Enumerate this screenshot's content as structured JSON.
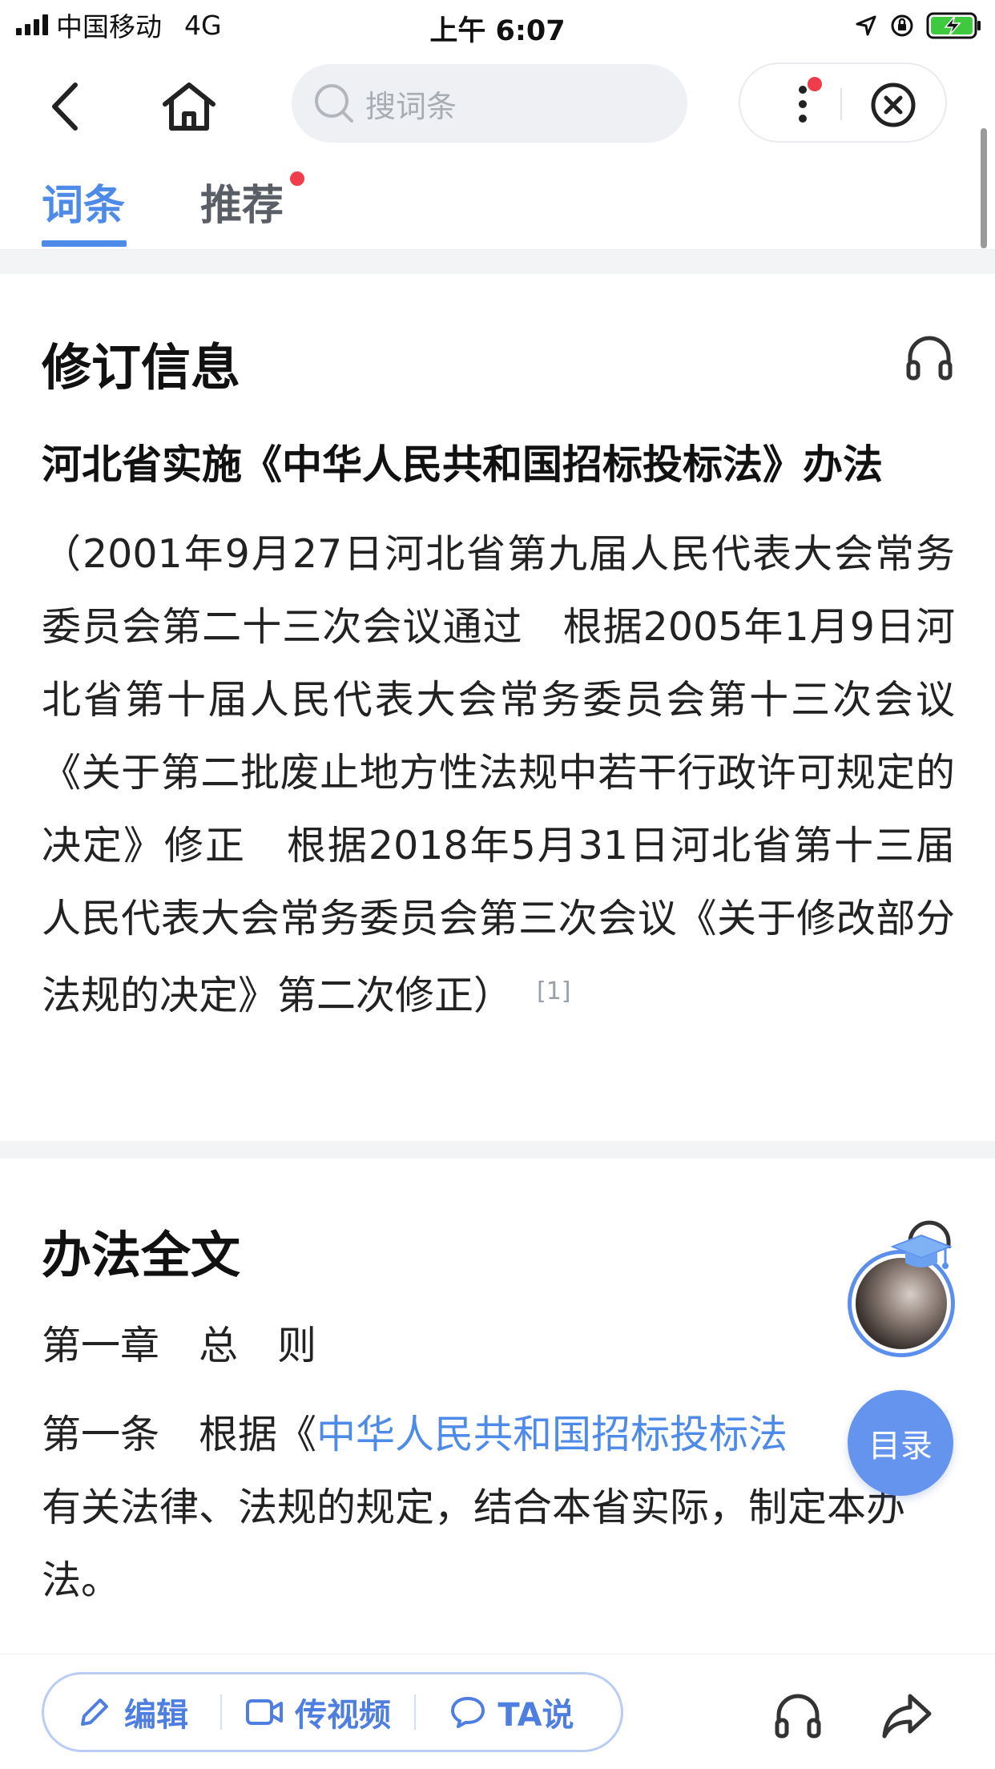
{
  "status_bar": {
    "carrier": "中国移动",
    "network": "4G",
    "time": "上午 6:07",
    "icons": [
      "signal-icon",
      "location-icon",
      "orientation-lock-icon",
      "battery-charging-icon"
    ]
  },
  "nav": {
    "search_placeholder": "搜词条",
    "icons": [
      "back-icon",
      "home-icon",
      "search-icon",
      "more-icon",
      "close-circle-icon"
    ],
    "has_notification_dot": true
  },
  "tabs": [
    {
      "label": "词条",
      "active": true
    },
    {
      "label": "推荐",
      "active": false,
      "badge_dot": true
    }
  ],
  "revision": {
    "title": "修订信息",
    "law_title": "河北省实施《中华人民共和国招标投标法》办法",
    "text": "（2001年9月27日河北省第九届人民代表大会常务委员会第二十三次会议通过　根据2005年1月9日河北省第十届人民代表大会常务委员会第十三次会议《关于第二批废止地方性法规中若干行政许可规定的决定》修正　根据2018年5月31日河北省第十三届人民代表大会常务委员会第三次会议《关于修改部分法规的决定》第二次修正）",
    "ref": "[1]"
  },
  "fulltext": {
    "title": "办法全文",
    "chapter": "第一章　总　则",
    "article_prefix": "第一条　根据《",
    "article_link": "中华人民共和国招标投标法",
    "article_rest": "有关法律、法规的规定，结合本省实际，制定本办法。"
  },
  "floating": {
    "toc_label": "目录"
  },
  "bottom_bar": {
    "edit_label": "编辑",
    "video_label": "传视频",
    "ta_label": "TA说"
  },
  "colors": {
    "accent": "#4e8be8",
    "red_dot": "#ef3d4b",
    "toc_button": "#6494ee"
  }
}
